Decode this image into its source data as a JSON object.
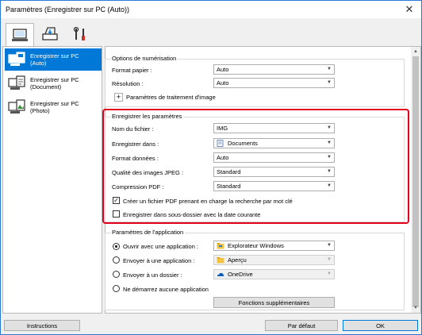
{
  "window": {
    "title": "Paramètres (Enregistrer sur PC (Auto))",
    "close_glyph": "✕"
  },
  "tabs": [
    {
      "icon": "computer-scan-icon",
      "active": true
    },
    {
      "icon": "scanner-icon",
      "active": false
    },
    {
      "icon": "tools-icon",
      "active": false
    }
  ],
  "sidebar": {
    "items": [
      {
        "label": "Enregistrer sur PC\n(Auto)",
        "active": true
      },
      {
        "label": "Enregistrer sur PC\n(Document)",
        "active": false
      },
      {
        "label": "Enregistrer sur PC\n(Photo)",
        "active": false
      }
    ]
  },
  "scan_options": {
    "legend": "Options de numérisation",
    "paper_size_label": "Format papier :",
    "paper_size_value": "Auto",
    "resolution_label": "Résolution :",
    "resolution_value": "Auto",
    "image_processing_label": "Paramètres de traitement d'image",
    "plus": "+"
  },
  "save_settings": {
    "legend": "Enregistrer les paramètres",
    "filename_label": "Nom du fichier :",
    "filename_value": "IMG",
    "save_in_label": "Enregistrer dans :",
    "save_in_value": "Documents",
    "format_label": "Format données :",
    "format_value": "Auto",
    "jpeg_quality_label": "Qualité des images JPEG :",
    "jpeg_quality_value": "Standard",
    "pdf_compression_label": "Compression PDF :",
    "pdf_compression_value": "Standard",
    "searchable_pdf_label": "Créer un fichier PDF prenant en charge la recherche par mot clé",
    "searchable_pdf_checked": true,
    "subfolder_label": "Enregistrer dans sous-dossier avec la date courante",
    "subfolder_checked": false
  },
  "app_settings": {
    "legend": "Paramètres de l'application",
    "open_app_label": "Ouvrir avec une application :",
    "open_app_value": "Explorateur Windows",
    "send_app_label": "Envoyer à une application :",
    "send_app_value": "Aperçu",
    "send_folder_label": "Envoyer à un dossier :",
    "send_folder_value": "OneDrive",
    "no_app_label": "Ne démarrez aucune application",
    "selected": "open_app",
    "more_functions_label": "Fonctions supplémentaires"
  },
  "footer": {
    "instructions_label": "Instructions",
    "defaults_label": "Par défaut",
    "ok_label": "OK"
  },
  "colors": {
    "accent": "#0078d7",
    "highlight": "#e2001a",
    "window_border": "#2b79d7"
  },
  "combo_arrow": "▼",
  "scroll_up": "▲",
  "scroll_down": "▼",
  "check_mark": "✓"
}
